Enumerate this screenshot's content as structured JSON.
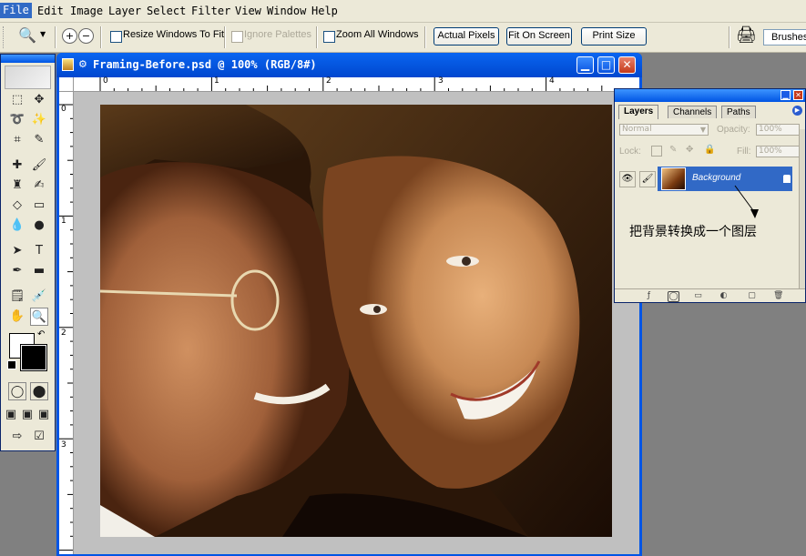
{
  "menu": [
    "File",
    "Edit",
    "Image",
    "Layer",
    "Select",
    "Filter",
    "View",
    "Window",
    "Help"
  ],
  "options_bar": {
    "resize_windows_label": "Resize Windows To Fit",
    "ignore_palettes_label": "Ignore Palettes",
    "zoom_all_label": "Zoom All Windows",
    "actual_pixels_label": "Actual Pixels",
    "fit_on_screen_label": "Fit On Screen",
    "print_size_label": "Print Size",
    "brushes_label": "Brushes"
  },
  "document": {
    "title": "Framing-Before.psd @ 100% (RGB/8#)",
    "ruler_top": [
      "0",
      "1",
      "2",
      "3",
      "4"
    ],
    "ruler_left": [
      "0",
      "1",
      "2",
      "3"
    ]
  },
  "layers_panel": {
    "tabs": [
      "Layers",
      "Channels",
      "Paths"
    ],
    "blend_mode": "Normal",
    "opacity_label": "Opacity:",
    "opacity_value": "100%",
    "lock_label": "Lock:",
    "fill_label": "Fill:",
    "fill_value": "100%",
    "layer_name": "Background",
    "annotation": "把背景转换成一个图层"
  },
  "colors": {
    "title_blue": "#0054e3",
    "selection_blue": "#3169c6",
    "chrome": "#ece9d8"
  }
}
